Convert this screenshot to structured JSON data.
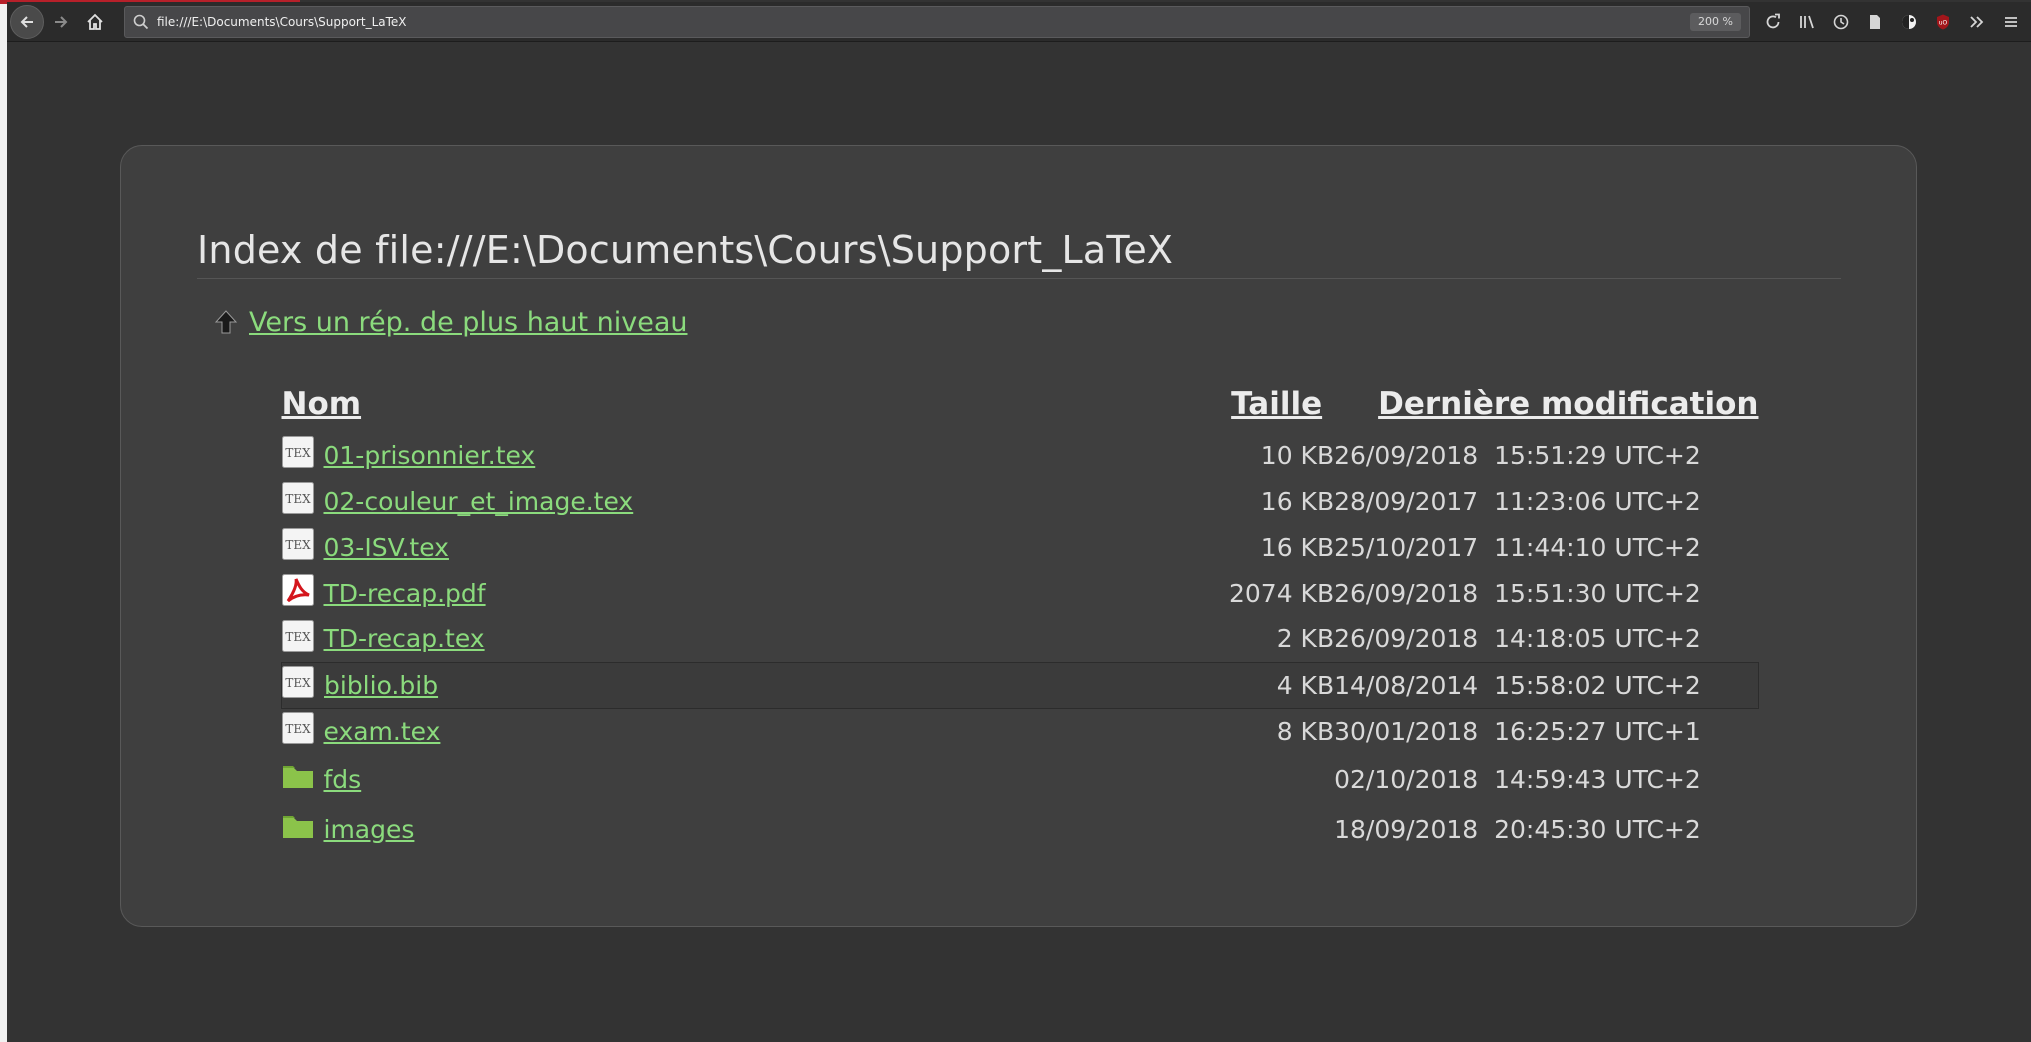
{
  "browser": {
    "url": "file:///E:\\Documents\\Cours\\Support_LaTeX",
    "zoom": "200 %",
    "toolbar_icons": [
      "reload-icon",
      "library-icon",
      "history-icon",
      "reader-icon",
      "extension-icon",
      "ublock-icon",
      "overflow-icon",
      "menu-icon"
    ]
  },
  "page": {
    "title": "Index de file:///E:\\Documents\\Cours\\Support_LaTeX",
    "parent_link": "Vers un rép. de plus haut niveau",
    "columns": {
      "name": "Nom",
      "size": "Taille",
      "modified": "Dernière modification"
    },
    "entries": [
      {
        "icon": "tex-file-icon",
        "name": "01-prisonnier.tex",
        "size": "10 KB",
        "date": "26/09/2018",
        "time": "15:51:29 UTC+2"
      },
      {
        "icon": "tex-file-icon",
        "name": "02-couleur_et_image.tex",
        "size": "16 KB",
        "date": "28/09/2017",
        "time": "11:23:06 UTC+2"
      },
      {
        "icon": "tex-file-icon",
        "name": "03-ISV.tex",
        "size": "16 KB",
        "date": "25/10/2017",
        "time": "11:44:10 UTC+2"
      },
      {
        "icon": "pdf-file-icon",
        "name": "TD-recap.pdf",
        "size": "2074 KB",
        "date": "26/09/2018",
        "time": "15:51:30 UTC+2"
      },
      {
        "icon": "tex-file-icon",
        "name": "TD-recap.tex",
        "size": "2 KB",
        "date": "26/09/2018",
        "time": "14:18:05 UTC+2"
      },
      {
        "icon": "tex-file-icon",
        "name": "biblio.bib",
        "size": "4 KB",
        "date": "14/08/2014",
        "time": "15:58:02 UTC+2"
      },
      {
        "icon": "tex-file-icon",
        "name": "exam.tex",
        "size": "8 KB",
        "date": "30/01/2018",
        "time": "16:25:27 UTC+1"
      },
      {
        "icon": "folder-icon",
        "name": "fds",
        "size": "",
        "date": "02/10/2018",
        "time": "14:59:43 UTC+2"
      },
      {
        "icon": "folder-icon",
        "name": "images",
        "size": "",
        "date": "18/09/2018",
        "time": "20:45:30 UTC+2"
      }
    ]
  },
  "colors": {
    "link": "#8bdb7d",
    "panel_bg": "#3f3f3f",
    "page_bg": "#333333"
  }
}
